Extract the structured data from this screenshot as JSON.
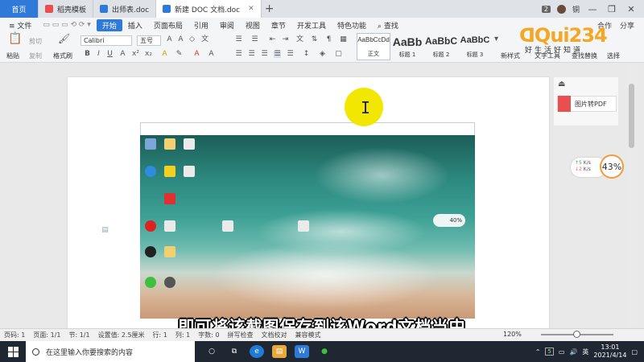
{
  "tabs": {
    "home": "首页",
    "items": [
      {
        "label": "稻壳模板",
        "color": "#e94f4f"
      },
      {
        "label": "出师表.doc",
        "color": "#2f7ad9"
      },
      {
        "label": "新建 DOC 文档.doc",
        "color": "#2f7ad9"
      }
    ],
    "add": "+",
    "badge": "2",
    "user_initial": "铜"
  },
  "menu": {
    "file": "≡ 文件",
    "items": [
      "开始",
      "插入",
      "页面布局",
      "引用",
      "审阅",
      "视图",
      "章节",
      "开发工具",
      "特色功能"
    ],
    "search": "查找",
    "right": [
      "合作",
      "分享"
    ]
  },
  "ribbon": {
    "paste": "粘贴",
    "cut": "剪切",
    "copy": "复制",
    "format_painter": "格式刷",
    "font": "Calibri",
    "size": "五号",
    "styles": [
      {
        "preview": "AaBbCcDd",
        "label": "正文"
      },
      {
        "preview": "AaBb",
        "label": "标题 1"
      },
      {
        "preview": "AaBbC",
        "label": "标题 2"
      },
      {
        "preview": "AaBbC",
        "label": "标题 3"
      }
    ],
    "new_style": "新样式",
    "text_tools": "文字工具",
    "find_replace": "查找替换",
    "select": "选择"
  },
  "logo": {
    "text": "ᗡQui234",
    "sub": "好生活好知道"
  },
  "side": {
    "pdf_label": "图片转PDF",
    "speed_up": "↑5",
    "speed_up_unit": "K/s",
    "speed_down": "↓2",
    "speed_down_unit": "K/s",
    "cpu": "43%",
    "shot_bubble": "40%"
  },
  "subtitle": "即可将该截图保存到该Word文档当中",
  "status": {
    "items": [
      "页码: 1",
      "页面: 1/1",
      "节: 1/1",
      "设置值: 2.5厘米",
      "行: 1",
      "列: 1",
      "字数: 0",
      "拼写检查",
      "文档校对",
      "兼容模式"
    ],
    "zoom": "120%",
    "zoom_level": 0.45
  },
  "taskbar": {
    "search_placeholder": "在这里输入你要搜索的内容",
    "apps": [
      "○",
      "⧉",
      "e",
      "▤",
      "W",
      "●"
    ],
    "battery": "5",
    "ime": "英",
    "time": "13:01",
    "date": "2021/4/14"
  },
  "colors": {
    "accent": "#2f7ad9",
    "cursor_highlight": "#f2e700",
    "speed_ring": "#f59a3c"
  }
}
